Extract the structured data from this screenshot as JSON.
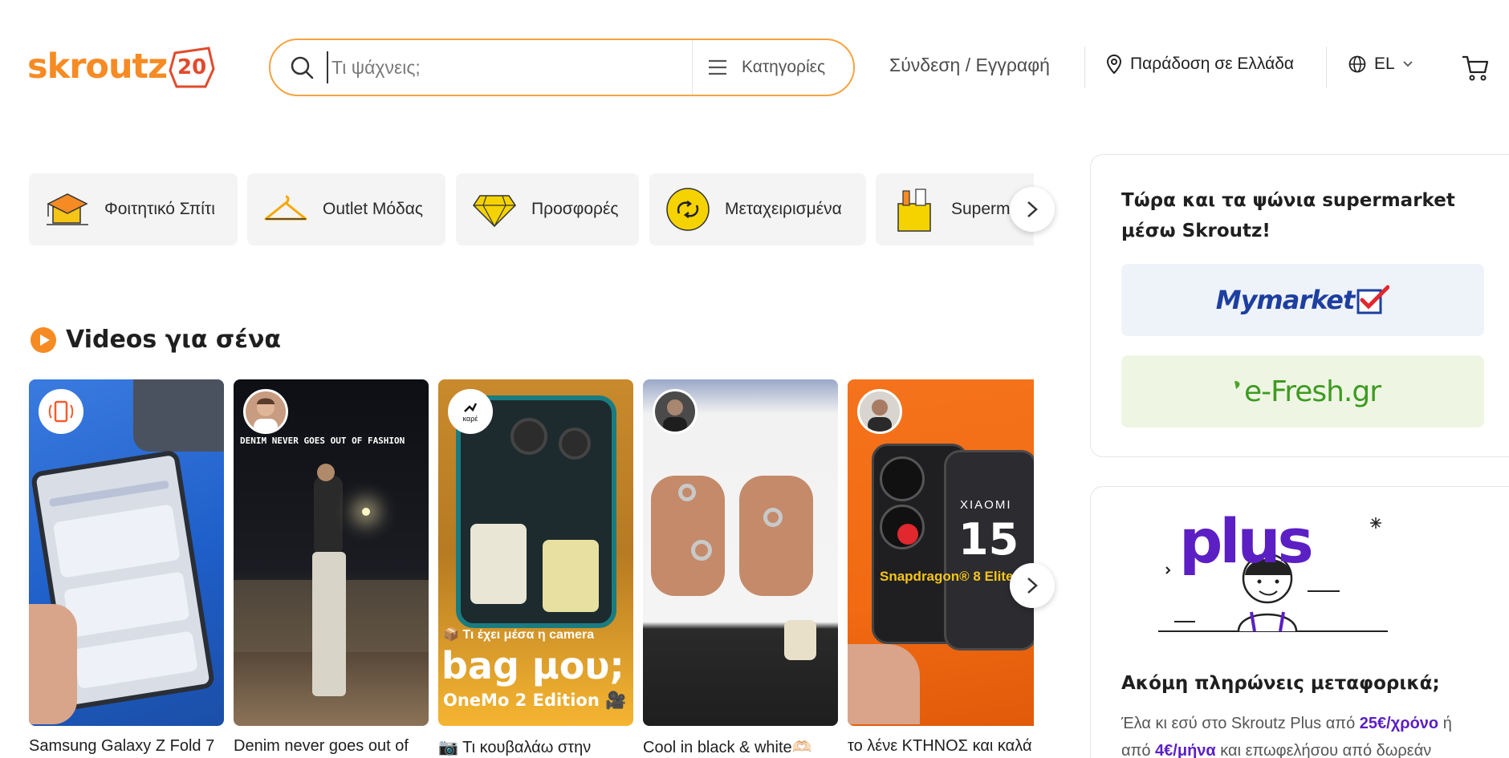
{
  "header": {
    "logo_text": "skroutz",
    "logo_badge": "20",
    "search_placeholder": "Τι ψάχνεις;",
    "categories_label": "Κατηγορίες",
    "login_label": "Σύνδεση / Εγγραφή",
    "delivery_label": "Παράδοση σε Ελλάδα",
    "language_label": "EL"
  },
  "chips": [
    {
      "label": "Φοιτητικό Σπίτι",
      "icon": "graduation-cap-icon"
    },
    {
      "label": "Outlet Μόδας",
      "icon": "hanger-icon"
    },
    {
      "label": "Προσφορές",
      "icon": "diamond-icon"
    },
    {
      "label": "Μεταχειρισμένα",
      "icon": "recycle-icon"
    },
    {
      "label": "Supermarket",
      "icon": "grocery-bag-icon"
    }
  ],
  "videos": {
    "title": "Videos για σένα",
    "items": [
      {
        "caption": "Samsung Galaxy Z Fold 7",
        "overlay": ""
      },
      {
        "caption": "Denim never goes out of",
        "overlay": "DENIM NEVER GOES OUT OF FASHION"
      },
      {
        "caption": "📷 Τι κουβαλάω στην",
        "overlay_small": "📦 Τι έχει μέσα η camera",
        "overlay_big": "bag μου;",
        "overlay_sub": "OneMo 2 Edition 🎥",
        "avatar_text": "καρέ"
      },
      {
        "caption": "Cool in black & white🫶🏻",
        "overlay": ""
      },
      {
        "caption": "το λένε ΚΤΗΝΟΣ και καλά",
        "overlay_brand": "XIAOMI",
        "overlay_model": "15",
        "overlay_chip": "Snapdragon® 8 Elite"
      }
    ]
  },
  "supermarket_panel": {
    "title": "Τώρα και τα ψώνια supermarket μέσω Skroutz!",
    "store1": "Mymarket",
    "store2": "e-Fresh.gr"
  },
  "plus_panel": {
    "logo": "plus",
    "title": "Ακόμη πληρώνεις μεταφορικά;",
    "text_1": "Έλα κι εσύ στο Skroutz Plus από ",
    "price_year": "25€/χρόνο",
    "text_2": " ή από ",
    "price_month": "4€/μήνα",
    "text_3": " και επωφελήσου από δωρεάν"
  },
  "colors": {
    "brand_orange": "#f68b24",
    "plus_purple": "#5b1fc4",
    "chip_bg": "#f4f4f4"
  }
}
